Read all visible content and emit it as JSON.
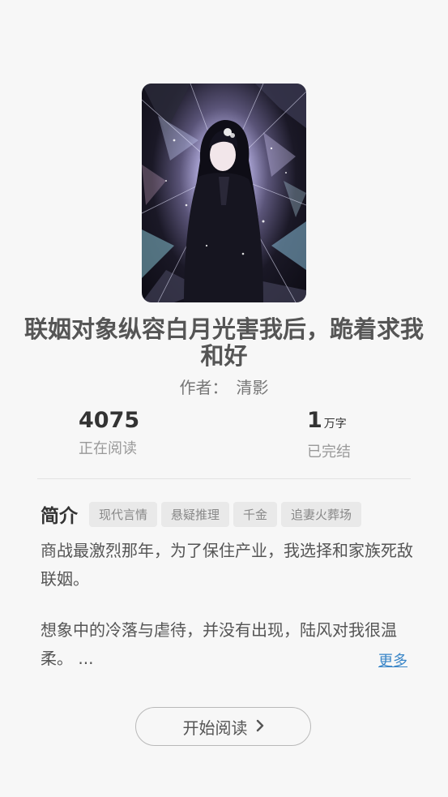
{
  "book": {
    "title": "联姻对象纵容白月光害我后，跪着求我和好",
    "author_label": "作者：",
    "author_name": "清影"
  },
  "stats": {
    "readers_value": "4075",
    "readers_label": "正在阅读",
    "words_value": "1",
    "words_unit": "万字",
    "status_label": "已完结"
  },
  "intro": {
    "heading": "简介",
    "tags": [
      "现代言情",
      "悬疑推理",
      "千金",
      "追妻火葬场"
    ],
    "paragraph1": "商战最激烈那年，为了保住产业，我选择和家族死敌联姻。",
    "paragraph2": "想象中的冷落与虐待，并没有出现，陆风对我很温柔。 ...",
    "more_label": "更多"
  },
  "actions": {
    "start_reading_label": "开始阅读"
  },
  "colors": {
    "background": "#f7f7f7",
    "link": "#3a86c8",
    "tag_bg": "#e9e9e9"
  },
  "icons": {
    "start_reading": "chevron-right-icon"
  }
}
